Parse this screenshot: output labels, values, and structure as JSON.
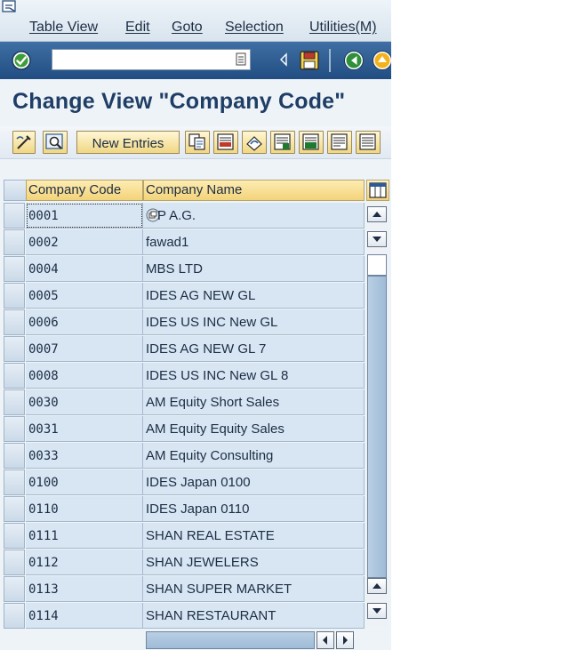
{
  "menu": {
    "items": [
      "Table View",
      "Edit",
      "Goto",
      "Selection",
      "Utilities(M)"
    ]
  },
  "toolbar": {
    "command_value": "",
    "icons": [
      "enter-icon",
      "history-dropdown-icon",
      "collapse-arrow-icon",
      "save-icon",
      "back-icon",
      "exit-icon"
    ]
  },
  "title": "Change View \"Company Code\"",
  "app_toolbar": {
    "new_entries_label": "New Entries",
    "icons": [
      "display-change-icon",
      "details-icon",
      "copy-icon",
      "delete-icon",
      "undo-icon",
      "select-all-icon",
      "select-block-icon",
      "deselect-all-icon",
      "more-icon"
    ]
  },
  "table": {
    "headers": [
      "Company Code",
      "Company Name"
    ],
    "rows": [
      {
        "code": "0001",
        "name": "P A.G."
      },
      {
        "code": "0002",
        "name": "fawad1"
      },
      {
        "code": "0004",
        "name": "MBS LTD"
      },
      {
        "code": "0005",
        "name": "IDES AG NEW GL"
      },
      {
        "code": "0006",
        "name": "IDES US INC New GL"
      },
      {
        "code": "0007",
        "name": "IDES AG NEW GL 7"
      },
      {
        "code": "0008",
        "name": "IDES US INC New GL 8"
      },
      {
        "code": "0030",
        "name": "AM Equity Short Sales"
      },
      {
        "code": "0031",
        "name": "AM Equity Equity Sales"
      },
      {
        "code": "0033",
        "name": "AM Equity Consulting"
      },
      {
        "code": "0100",
        "name": "IDES Japan 0100"
      },
      {
        "code": "0110",
        "name": "IDES Japan 0110"
      },
      {
        "code": "0111",
        "name": "SHAN REAL ESTATE"
      },
      {
        "code": "0112",
        "name": "SHAN JEWELERS"
      },
      {
        "code": "0113",
        "name": "SHAN SUPER MARKET"
      },
      {
        "code": "0114",
        "name": "SHAN RESTAURANT"
      }
    ]
  },
  "colors": {
    "toolbar_blue": "#2a5a90",
    "title_blue": "#1f3e66",
    "header_gold": "#f3d37a",
    "cell_blue": "#d8e6f3"
  }
}
